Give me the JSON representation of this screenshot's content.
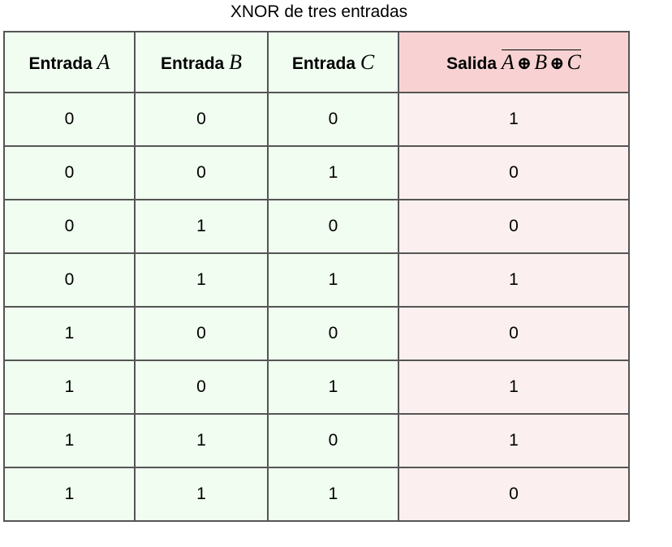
{
  "caption": "XNOR de tres entradas",
  "headers": {
    "a": {
      "label": "Entrada",
      "var": "A"
    },
    "b": {
      "label": "Entrada",
      "var": "B"
    },
    "c": {
      "label": "Entrada",
      "var": "C"
    },
    "out": {
      "label": "Salida",
      "expr": [
        "A",
        "⊕",
        "B",
        "⊕",
        "C"
      ]
    }
  },
  "rows": [
    [
      "0",
      "0",
      "0",
      "1"
    ],
    [
      "0",
      "0",
      "1",
      "0"
    ],
    [
      "0",
      "1",
      "0",
      "0"
    ],
    [
      "0",
      "1",
      "1",
      "1"
    ],
    [
      "1",
      "0",
      "0",
      "0"
    ],
    [
      "1",
      "0",
      "1",
      "1"
    ],
    [
      "1",
      "1",
      "0",
      "1"
    ],
    [
      "1",
      "1",
      "1",
      "0"
    ]
  ],
  "colors": {
    "input_header": "#f0fdf0",
    "output_header": "#f8d2d2",
    "output_cell": "#fcefef",
    "border": "#555555"
  }
}
